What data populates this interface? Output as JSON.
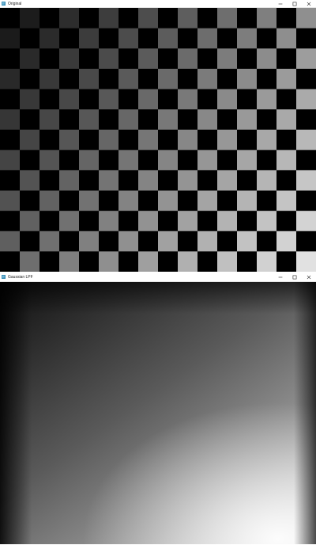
{
  "windows": {
    "original": {
      "title": "Original",
      "icon": "app-window-icon"
    },
    "gaussian": {
      "title": "Gaussian LPF",
      "icon": "app-window-icon"
    }
  },
  "controls": {
    "minimize_icon": "minimize-icon",
    "maximize_icon": "maximize-icon",
    "close_icon": "close-icon"
  },
  "image": {
    "checkerboard_columns": 16,
    "checkerboard_rows": 13,
    "dark_color": "#000000",
    "gradient_start": "#000000",
    "gradient_end": "#ffffff"
  }
}
